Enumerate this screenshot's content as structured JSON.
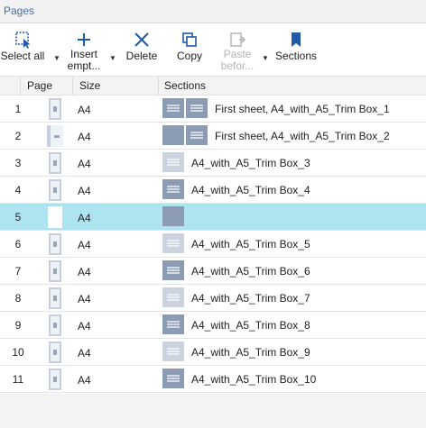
{
  "panel": {
    "title": "Pages"
  },
  "toolbar": {
    "select_all": "Select all",
    "insert_empty_1": "Insert",
    "insert_empty_2": "empt...",
    "delete": "Delete",
    "copy": "Copy",
    "paste_before_1": "Paste",
    "paste_before_2": "befor...",
    "sections": "Sections"
  },
  "columns": {
    "page": "Page",
    "size": "Size",
    "sections": "Sections"
  },
  "rows": [
    {
      "page": "1",
      "size": "A4",
      "section": "First sheet, A4_with_A5_Trim Box_1"
    },
    {
      "page": "2",
      "size": "A4",
      "section": "First sheet, A4_with_A5_Trim Box_2"
    },
    {
      "page": "3",
      "size": "A4",
      "section": "A4_with_A5_Trim Box_3"
    },
    {
      "page": "4",
      "size": "A4",
      "section": "A4_with_A5_Trim Box_4"
    },
    {
      "page": "5",
      "size": "A4",
      "section": ""
    },
    {
      "page": "6",
      "size": "A4",
      "section": "A4_with_A5_Trim Box_5"
    },
    {
      "page": "7",
      "size": "A4",
      "section": "A4_with_A5_Trim Box_6"
    },
    {
      "page": "8",
      "size": "A4",
      "section": "A4_with_A5_Trim Box_7"
    },
    {
      "page": "9",
      "size": "A4",
      "section": "A4_with_A5_Trim Box_8"
    },
    {
      "page": "10",
      "size": "A4",
      "section": "A4_with_A5_Trim Box_9"
    },
    {
      "page": "11",
      "size": "A4",
      "section": "A4_with_A5_Trim Box_10"
    }
  ],
  "colors": {
    "accent": "#1e5aa8",
    "selected_row": "#aee4ef",
    "section_dark": "#8b9bb4",
    "section_light": "#ccd3df"
  }
}
